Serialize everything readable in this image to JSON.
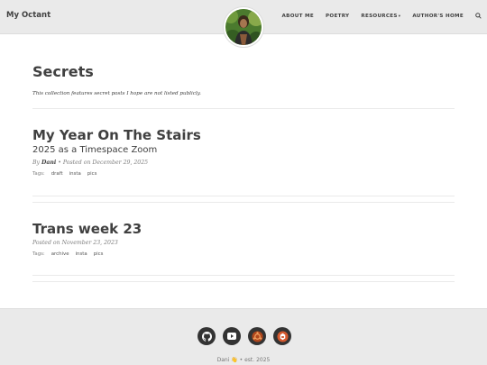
{
  "nav": {
    "brand": "My Octant",
    "links": [
      "About Me",
      "Poetry",
      "Resources",
      "Author's Home"
    ]
  },
  "page": {
    "title": "Secrets",
    "subtitle": "This collection features secret posts I hope are not listed publicly."
  },
  "posts": [
    {
      "title": "My Year On The Stairs",
      "subtitle": "2025 as a Timespace Zoom",
      "by_prefix": "By",
      "author": "Dani",
      "posted": "• Posted on December 29, 2025",
      "tags_label": "Tags:",
      "tags": [
        "draft",
        "insta",
        "pics"
      ]
    },
    {
      "title": "Trans week 23",
      "posted": "Posted on November 23, 2023",
      "tags_label": "Tags:",
      "tags": [
        "archive",
        "insta",
        "pics"
      ]
    }
  ],
  "footer": {
    "socials": [
      "github-icon",
      "youtube-icon",
      "ubuntu-icon",
      "mastodon-icon"
    ],
    "text": "Dani 👋 • est. 2025"
  },
  "colors": {
    "navbar_bg": "#eaeaea",
    "footer_bg": "#eaeaea",
    "text": "#404040",
    "muted": "#808080",
    "social_dark": "#333333",
    "social_ubuntu": "#b0471c",
    "social_red": "#d4582e"
  }
}
